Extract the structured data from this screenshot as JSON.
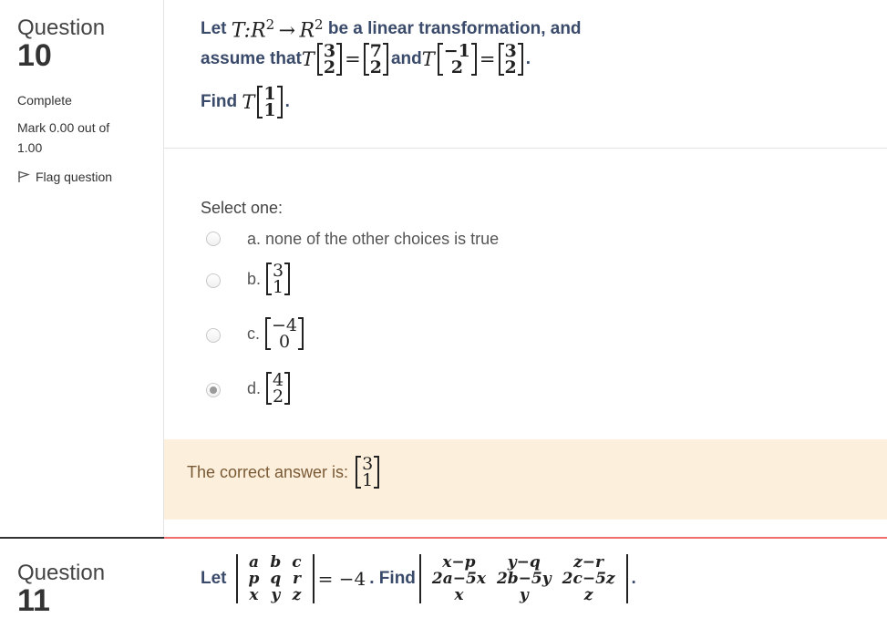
{
  "q10": {
    "label": "Question",
    "number": "10",
    "status": "Complete",
    "mark": "Mark 0.00 out of",
    "mark_total": "1.00",
    "flag": "Flag question",
    "text": {
      "let": "Let",
      "tmap": "T:R",
      "sup": "2",
      "arrow": "→",
      "r2": "R",
      "tail": "be a linear transformation, and",
      "assume": "assume that",
      "t": "T",
      "eq": "=",
      "and": "and",
      "find": "Find",
      "period": "."
    },
    "v1": [
      "3",
      "2"
    ],
    "r1": [
      "7",
      "2"
    ],
    "v2": [
      "−1",
      "2"
    ],
    "r2v": [
      "3",
      "2"
    ],
    "v3": [
      "1",
      "1"
    ],
    "select_one": "Select one:",
    "options": [
      {
        "letter": "a.",
        "text": "none of the other choices is true",
        "selected": false
      },
      {
        "letter": "b.",
        "vec": [
          "3",
          "1"
        ],
        "selected": false
      },
      {
        "letter": "c.",
        "vec": [
          "−4",
          "0"
        ],
        "selected": false
      },
      {
        "letter": "d.",
        "vec": [
          "4",
          "2"
        ],
        "selected": true
      }
    ],
    "feedback": "The correct answer is:",
    "answer_vec": [
      "3",
      "1"
    ]
  },
  "q11": {
    "label": "Question",
    "number": "11",
    "let": "Let",
    "m1": [
      [
        "a",
        "b",
        "c"
      ],
      [
        "p",
        "q",
        "r"
      ],
      [
        "x",
        "y",
        "z"
      ]
    ],
    "eq": "= −4",
    "find": ". Find",
    "m2": [
      [
        "x−p",
        "y−q",
        "z−r"
      ],
      [
        "2a−5x",
        "2b−5y",
        "2c−5z"
      ],
      [
        "x",
        "y",
        "z"
      ]
    ],
    "period": "."
  }
}
